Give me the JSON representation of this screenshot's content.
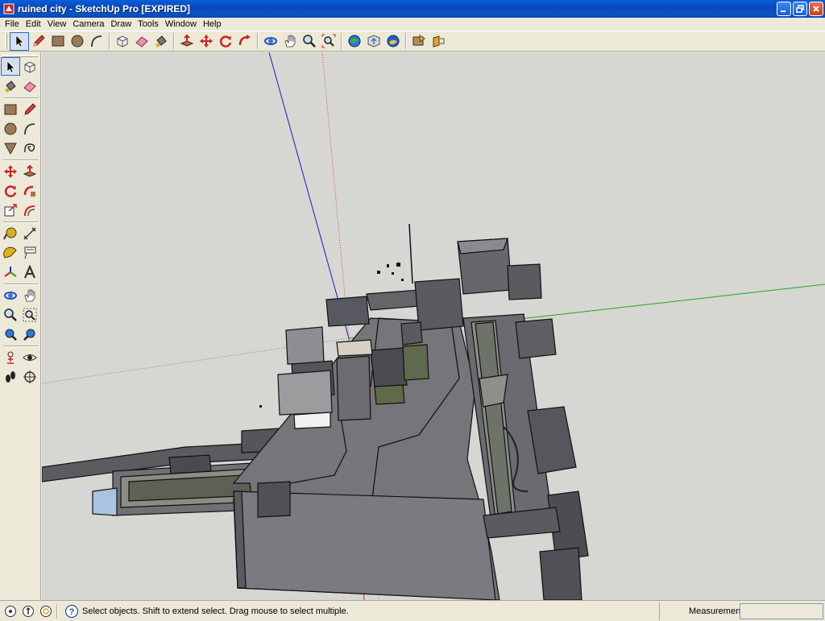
{
  "window": {
    "title": "ruined city - SketchUp Pro [EXPIRED]"
  },
  "menu": [
    "File",
    "Edit",
    "View",
    "Camera",
    "Draw",
    "Tools",
    "Window",
    "Help"
  ],
  "toolbar": {
    "tools": [
      "select-icon",
      "pencil-icon",
      "rectangle-icon",
      "circle-icon",
      "arc-icon",
      "make-component-icon",
      "eraser-icon",
      "paint-bucket-icon",
      "push-pull-icon",
      "move-icon",
      "rotate-icon",
      "follow-me-icon",
      "orbit-icon",
      "pan-icon",
      "zoom-icon",
      "zoom-extents-icon",
      "get-models-icon",
      "share-model-icon",
      "google-earth-icon",
      "get-photo-texture-icon",
      "section-plane-icon"
    ]
  },
  "left_toolbar": {
    "tools": [
      "select-icon",
      "make-component-icon",
      "paint-bucket-icon",
      "eraser-icon",
      "rectangle-icon",
      "pencil-icon",
      "circle-icon",
      "arc-icon",
      "polygon-icon",
      "freehand-icon",
      "move-icon",
      "push-pull-icon",
      "rotate-icon",
      "follow-me-icon",
      "scale-icon",
      "offset-icon",
      "tape-measure-icon",
      "dimension-icon",
      "protractor-icon",
      "text-icon",
      "axes-icon",
      "3d-text-icon",
      "orbit-icon",
      "pan-icon",
      "zoom-icon",
      "zoom-window-icon",
      "previous-view-icon",
      "next-view-icon",
      "position-camera-icon",
      "look-around-icon",
      "walk-icon",
      "section-plane-icon"
    ]
  },
  "status": {
    "hint": "Select objects. Shift to extend select. Drag mouse to select multiple.",
    "measurements_label": "Measurements"
  },
  "colors": {
    "viewport_bg": "#d6d6d3",
    "axis_blue": "#1b1bd0",
    "axis_red": "#d02020",
    "axis_green": "#1ea81e",
    "title_bar": "#0a53c4"
  }
}
